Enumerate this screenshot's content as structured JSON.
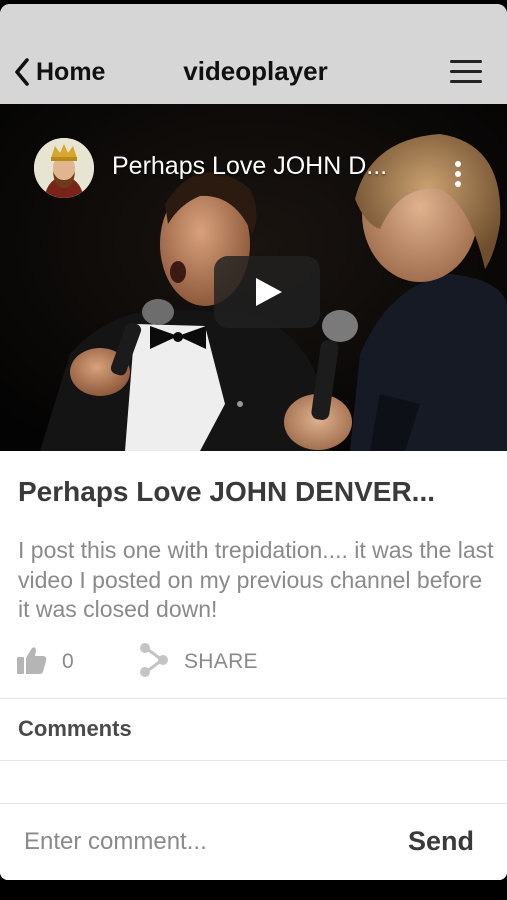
{
  "header": {
    "back_label": "Home",
    "back_icon": "chevron-left-icon",
    "title": "videoplayer",
    "menu_icon": "hamburger-menu-icon"
  },
  "video": {
    "title": "Perhaps Love JOHN D...",
    "channel_avatar": "channel-avatar",
    "more_icon": "vertical-dots-icon",
    "play_icon": "play-icon",
    "play_button_color": "#212121"
  },
  "details": {
    "title": "Perhaps Love  JOHN DENVER...",
    "description": "I post this one with trepidation.... it was the last video I posted on my previous channel before it was closed down!",
    "like_icon": "thumbs-up-icon",
    "like_count": "0",
    "share_icon": "share-icon",
    "share_label": "SHARE"
  },
  "comments": {
    "label": "Comments",
    "input_placeholder": "Enter comment...",
    "send_label": "Send"
  },
  "colors": {
    "header_bg": "#d6d6d6",
    "title_text": "#3a3a3a",
    "muted_text": "#8a8a8a"
  }
}
